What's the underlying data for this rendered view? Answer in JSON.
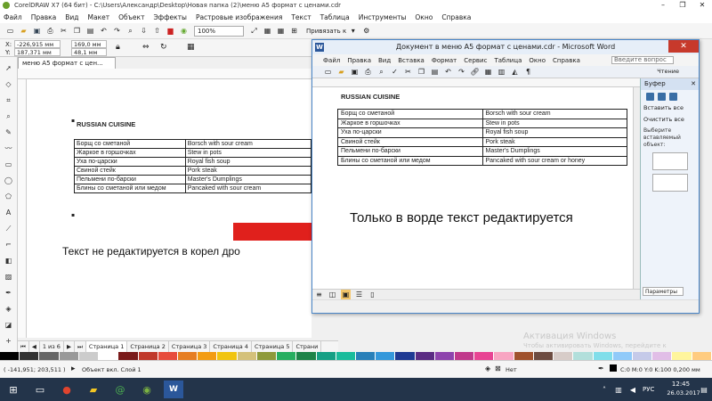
{
  "coreldraw": {
    "title": "CorelDRAW X7 (64 бит) - C:\\Users\\Александр\\Desktop\\Новая папка (2)\\меню А5 формат с ценами.cdr",
    "menu": [
      "Файл",
      "Правка",
      "Вид",
      "Макет",
      "Объект",
      "Эффекты",
      "Растровые изображения",
      "Текст",
      "Таблица",
      "Инструменты",
      "Окно",
      "Справка"
    ],
    "zoom": "100%",
    "snap": "Привязать к",
    "x": "-226,915 мм",
    "y": "187,371 мм",
    "w": "169,0 мм",
    "h": "48,1 мм",
    "doc_tab": "меню А5 формат с цен...",
    "heading": "RUSSIAN CUISINE",
    "table": [
      [
        "Борщ со сметаной",
        "Borsch with sour cream"
      ],
      [
        "Жаркое в горшочках",
        "Stew in pots"
      ],
      [
        "Уха по-царски",
        "Royal fish soup"
      ],
      [
        "Свиной стейк",
        "Pork steak"
      ],
      [
        "Пельмени по-барски",
        "Master's Dumplings"
      ],
      [
        "Блины со сметаной или медом",
        "Pancaked with sour cream"
      ]
    ],
    "note": "Текст не редактируется в корел дро",
    "page_counter": "1 из 6",
    "pages": [
      "Страница 1",
      "Страница 2",
      "Страница 3",
      "Страница 4",
      "Страница 5",
      "Страни"
    ],
    "status": {
      "coords": "( -141,951; 203,511 )",
      "object": "Объект вкл. Слой 1",
      "fill": "Нет",
      "stroke": "C:0 M:0 Y:0 K:100  0,200 мм"
    }
  },
  "word": {
    "title": "Документ в меню А5 формат с ценами.cdr - Microsoft Word",
    "menu": [
      "Файл",
      "Правка",
      "Вид",
      "Вставка",
      "Формат",
      "Сервис",
      "Таблица",
      "Окно",
      "Справка"
    ],
    "help_placeholder": "Введите вопрос",
    "read_label": "Чтение",
    "heading": "RUSSIAN CUISINE",
    "table": [
      [
        "Борщ со сметаной",
        "Borsch with sour cream"
      ],
      [
        "Жаркое в горшочках",
        "Stew in pots"
      ],
      [
        "Уха по-царски",
        "Royal fish soup"
      ],
      [
        "Свиной стейк",
        "Pork steak"
      ],
      [
        "Пельмени по-барски",
        "Master's Dumplings"
      ],
      [
        "Блины со сметаной или медом",
        "Pancaked with sour cream or honey"
      ]
    ],
    "note": "Только в ворде текст редактируется",
    "clipboard": {
      "title": "Буфер",
      "paste_all": "Вставить все",
      "clear_all": "Очистить все",
      "hint": "Выберите вставляемый объект:",
      "params": "Параметры"
    }
  },
  "activation": {
    "title": "Активация Windows",
    "subtitle": "Чтобы активировать Windows, перейдите к параметрам компьютера."
  },
  "taskbar": {
    "time": "12:45",
    "date": "26.03.2017",
    "lang": "РУС"
  },
  "colors": {
    "word_blue": "#2b579a",
    "arrow_red": "#e0201c",
    "taskbar": "#23344a"
  }
}
